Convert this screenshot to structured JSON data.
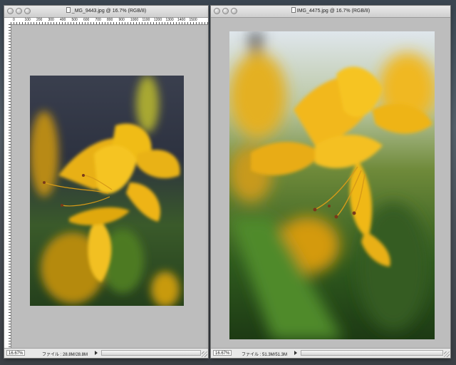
{
  "windows": [
    {
      "title": "_MG_9443.jpg @ 16.7% (RGB/8)",
      "ruler_labels": [
        "0",
        "100",
        "200",
        "300",
        "400",
        "500",
        "600",
        "700",
        "800",
        "900",
        "1000",
        "1100",
        "1200",
        "1300",
        "1400",
        "1500",
        "1600",
        "1700",
        "1800",
        "1900",
        "2000",
        "2100",
        "2200",
        "2300",
        "2400",
        "2500",
        "2600",
        "2700"
      ],
      "zoom": "16.67%",
      "file_info": "ファイル : 28.8M/28.8M"
    },
    {
      "title": "IMG_4475.jpg @ 16.7% (RGB/8)",
      "zoom": "16.67%",
      "file_info": "ファイル : 51.3M/51.3M"
    }
  ],
  "colors": {
    "canvas_gray": "#bdbdbd",
    "flower_yellow": "#f0b818",
    "foliage_green": "#3f6a2a"
  },
  "icons": [
    "document-icon",
    "close-icon",
    "minimize-icon",
    "zoom-icon",
    "status-arrow-icon",
    "resize-grip-icon"
  ]
}
